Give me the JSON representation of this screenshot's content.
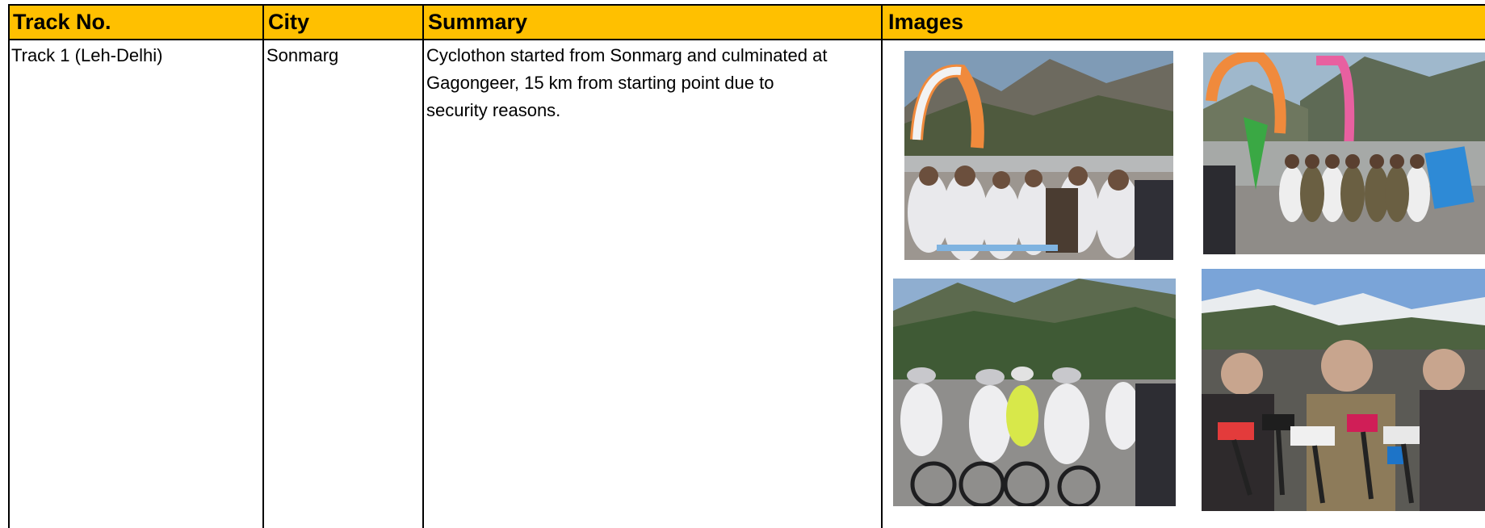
{
  "table": {
    "headers": {
      "track_no": "Track No.",
      "city": "City",
      "summary": "Summary",
      "images": "Images"
    },
    "rows": [
      {
        "track_no": "Track 1 (Leh-Delhi)",
        "city": "Sonmarg",
        "summary": "Cyclothon started from Sonmarg and culminated at Gagongeer, 15 km from starting point due to security reasons.",
        "summary_lines": [
          "Cyclothon started from Sonmarg and culminated at",
          "Gagongeer, 15 km from starting point due to",
          "security reasons."
        ]
      }
    ]
  },
  "colors": {
    "header_bg": "#ffc000",
    "grid": "#000000",
    "text": "#000000"
  }
}
